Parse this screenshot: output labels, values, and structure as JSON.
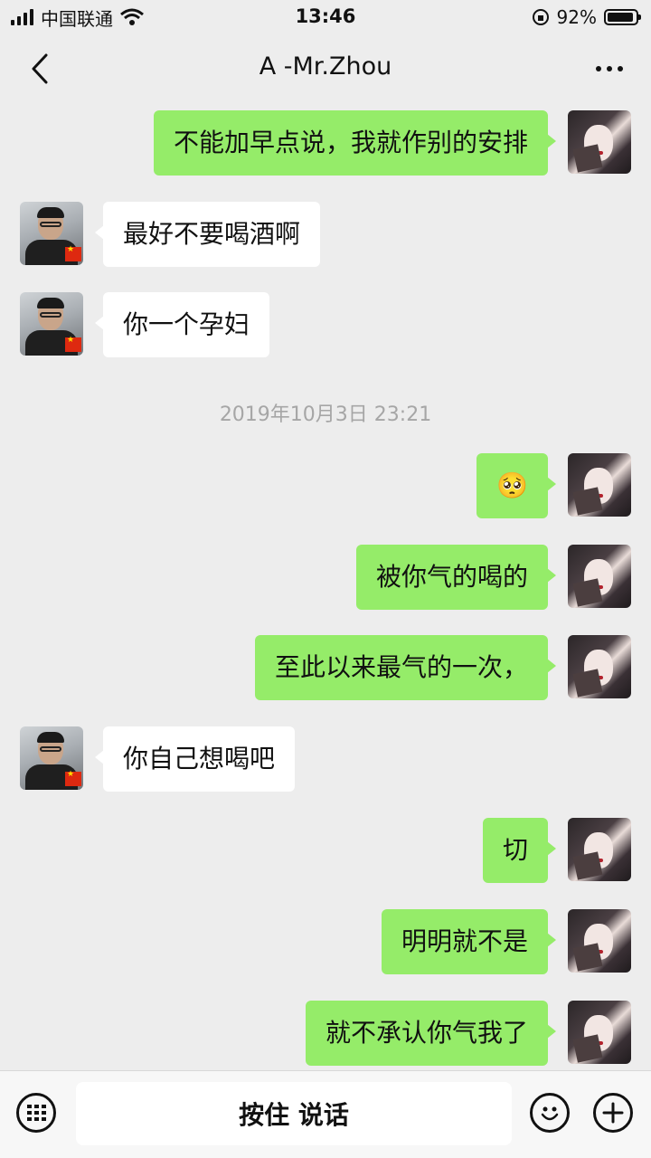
{
  "status_bar": {
    "carrier": "中国联通",
    "time": "13:46",
    "battery": "92%",
    "battery_level": 0.92
  },
  "header": {
    "title": "A -Mr.Zhou"
  },
  "messages": [
    {
      "from": "me",
      "text": "不能加早点说，我就作别的安排"
    },
    {
      "from": "contact",
      "text": "最好不要喝酒啊"
    },
    {
      "from": "contact",
      "text": "你一个孕妇"
    },
    {
      "from": "me",
      "text": "🥺",
      "emoji": true
    },
    {
      "from": "me",
      "text": "被你气的喝的"
    },
    {
      "from": "me",
      "text": "至此以来最气的一次，"
    },
    {
      "from": "contact",
      "text": "你自己想喝吧"
    },
    {
      "from": "me",
      "text": "切"
    },
    {
      "from": "me",
      "text": "明明就不是"
    },
    {
      "from": "me",
      "text": "就不承认你气我了"
    }
  ],
  "timestamp": "2019年10月3日 23:21",
  "bottom_bar": {
    "voice_label": "按住 说话"
  },
  "icons": {
    "back": "chevron-left-icon",
    "more": "more-dots-icon",
    "keyboard": "keyboard-icon",
    "emoji": "emoji-icon",
    "add": "plus-icon"
  },
  "colors": {
    "background": "#ededed",
    "outgoing_bubble": "#95ec69",
    "incoming_bubble": "#ffffff"
  }
}
